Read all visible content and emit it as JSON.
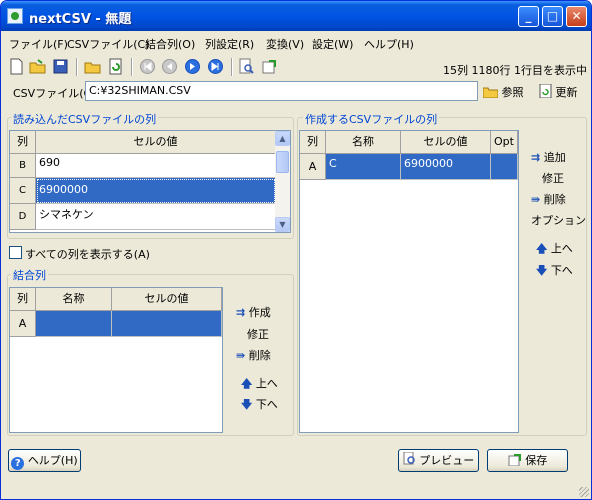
{
  "window": {
    "title": "nextCSV - 無題"
  },
  "menu": [
    "ファイル(F)",
    "CSVファイル(C)",
    "結合列(O)",
    "列設定(R)",
    "変換(V)",
    "設定(W)",
    "ヘルプ(H)"
  ],
  "status": "15列 1180行 1行目を表示中",
  "toolbar_icons": [
    "new-file-icon",
    "open-folder-icon",
    "save-icon",
    "open-csv-icon",
    "refresh-icon",
    "first-record-icon",
    "prev-record-icon",
    "next-record-icon",
    "last-record-icon",
    "search-icon",
    "export-icon"
  ],
  "csv": {
    "label": "CSVファイル(C)",
    "path": "C:¥32SHIMAN.CSV",
    "browse": "参照",
    "reload": "更新"
  },
  "read_section": {
    "title": "読み込んだCSVファイルの列",
    "headers": [
      "列",
      "セルの値"
    ],
    "rows": [
      {
        "col": "B",
        "value": "690"
      },
      {
        "col": "C",
        "value": "6900000"
      },
      {
        "col": "D",
        "value": "シマネケン"
      }
    ],
    "show_all": "すべての列を表示する(A)"
  },
  "join_section": {
    "title": "結合列",
    "headers": [
      "列",
      "名称",
      "セルの値"
    ],
    "rows": [
      {
        "col": "A",
        "name": "",
        "value": ""
      }
    ],
    "actions": [
      "作成",
      "修正",
      "削除",
      "上へ",
      "下へ"
    ]
  },
  "make_section": {
    "title": "作成するCSVファイルの列",
    "headers": [
      "列",
      "名称",
      "セルの値",
      "Opt"
    ],
    "rows": [
      {
        "col": "A",
        "name": "C",
        "value": "6900000",
        "opt": ""
      }
    ],
    "actions": [
      "追加",
      "修正",
      "削除",
      "オプション",
      "上へ",
      "下へ"
    ]
  },
  "bottom": {
    "help": "ヘルプ(H)",
    "preview": "プレビュー",
    "save": "保存"
  },
  "colors": {
    "selection": "#316ac5",
    "title_bar": "#0054e3",
    "section_title": "#0046d5"
  }
}
